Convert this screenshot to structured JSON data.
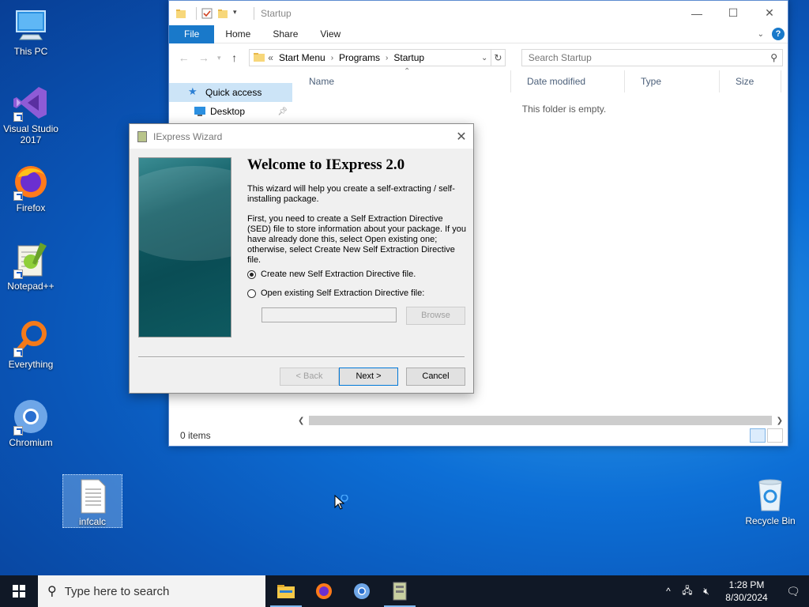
{
  "desktop": {
    "icons": [
      {
        "label": "This PC"
      },
      {
        "label": "Visual Studio 2017"
      },
      {
        "label": "Firefox"
      },
      {
        "label": "Notepad++"
      },
      {
        "label": "Everything"
      },
      {
        "label": "Chromium"
      },
      {
        "label": "infcalc"
      },
      {
        "label": "Recycle Bin"
      }
    ]
  },
  "explorer": {
    "title": "Startup",
    "tabs": [
      "File",
      "Home",
      "Share",
      "View"
    ],
    "address": {
      "prefix": "«",
      "crumbs": [
        "Start Menu",
        "Programs",
        "Startup"
      ]
    },
    "search_placeholder": "Search Startup",
    "nav": {
      "quick_access": "Quick access",
      "desktop": "Desktop"
    },
    "columns": [
      "Name",
      "Date modified",
      "Type",
      "Size"
    ],
    "empty_message": "This folder is empty.",
    "status": "0 items"
  },
  "dialog": {
    "title": "IExpress Wizard",
    "heading": "Welcome to IExpress 2.0",
    "para1": "This wizard will help you create a self-extracting / self-installing package.",
    "para2": "First, you need to create a Self Extraction Directive (SED) file to store information about your package.  If you have already done this, select Open existing one; otherwise, select Create New Self Extraction Directive file.",
    "radio_create": "Create new Self Extraction Directive file.",
    "radio_open": "Open existing Self Extraction Directive file:",
    "path_value": "",
    "browse": "Browse",
    "back": "< Back",
    "next": "Next >",
    "cancel": "Cancel"
  },
  "taskbar": {
    "search_placeholder": "Type here to search",
    "time": "1:28 PM",
    "date": "8/30/2024"
  },
  "colors": {
    "accent": "#1979ca",
    "taskbar": "#101826",
    "selection": "#cce4f7"
  }
}
